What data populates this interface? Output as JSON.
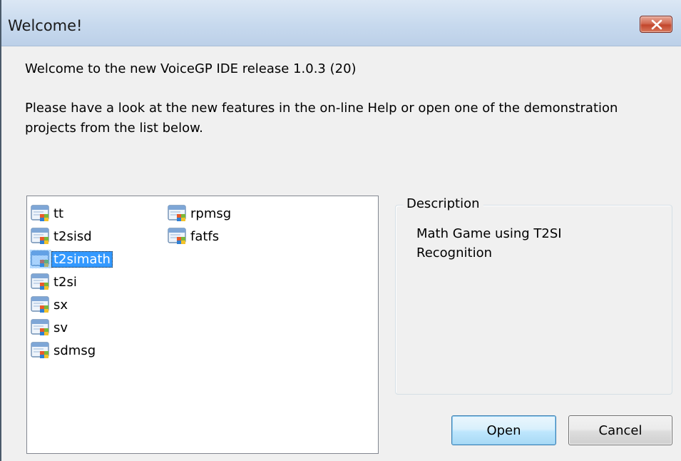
{
  "window": {
    "title": "Welcome!"
  },
  "welcome_text": "Welcome to the new VoiceGP IDE release 1.0.3 (20)",
  "info_text": "Please have a look at the new features in the on-line Help or open one of the demonstration projects from the list below.",
  "projects": {
    "column1": [
      {
        "label": "tt",
        "icon": "project-icon",
        "selected": false
      },
      {
        "label": "t2sisd",
        "icon": "project-icon",
        "selected": false
      },
      {
        "label": "t2simath",
        "icon": "project-icon",
        "selected": true
      },
      {
        "label": "t2si",
        "icon": "project-icon",
        "selected": false
      },
      {
        "label": "sx",
        "icon": "project-icon",
        "selected": false
      },
      {
        "label": "sv",
        "icon": "project-icon",
        "selected": false
      },
      {
        "label": "sdmsg",
        "icon": "project-icon",
        "selected": false
      }
    ],
    "column2": [
      {
        "label": "rpmsg",
        "icon": "project-icon",
        "selected": false
      },
      {
        "label": "fatfs",
        "icon": "project-icon",
        "selected": false
      }
    ]
  },
  "description": {
    "legend": "Description",
    "text": "Math Game using T2SI Recognition"
  },
  "buttons": {
    "open_label": "Open",
    "cancel_label": "Cancel"
  },
  "colors": {
    "selection": "#3399ff",
    "titlebar": "#c7d9ee",
    "close_button": "#c2462c"
  }
}
